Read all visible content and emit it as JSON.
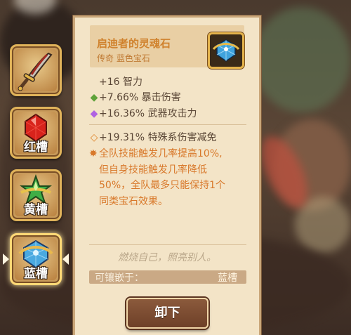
{
  "gem": {
    "name": "启迪者的灵魂石",
    "subtype": "传奇 蓝色宝石",
    "icon": "blue-gem-icon"
  },
  "stats": {
    "base": "+16 智力",
    "secondary": [
      {
        "text": "+7.66% 暴击伤害",
        "marker": "green-diamond-icon",
        "color": "#5fa23a"
      },
      {
        "text": "+16.36% 武器攻击力",
        "marker": "purple-diamond-icon",
        "color": "#b062e2"
      }
    ],
    "special": "+19.31% 特殊系伤害减免",
    "effect_lines": [
      "全队技能触发几率提高10%,",
      "但自身技能触发几率降低",
      "50%，全队最多只能保持1个",
      "同类宝石效果。"
    ]
  },
  "flavor_text": "燃烧自己，照亮别人。",
  "socket": {
    "label": "可镶嵌于：",
    "value": "蓝槽"
  },
  "button": {
    "label": "卸下"
  },
  "slots": [
    {
      "label": "",
      "icon": "sword-icon"
    },
    {
      "label": "红槽",
      "icon": "red-gem-icon"
    },
    {
      "label": "黄槽",
      "icon": "yellow-gem-icon"
    },
    {
      "label": "蓝槽",
      "icon": "blue-gem-icon",
      "selected": true
    }
  ]
}
